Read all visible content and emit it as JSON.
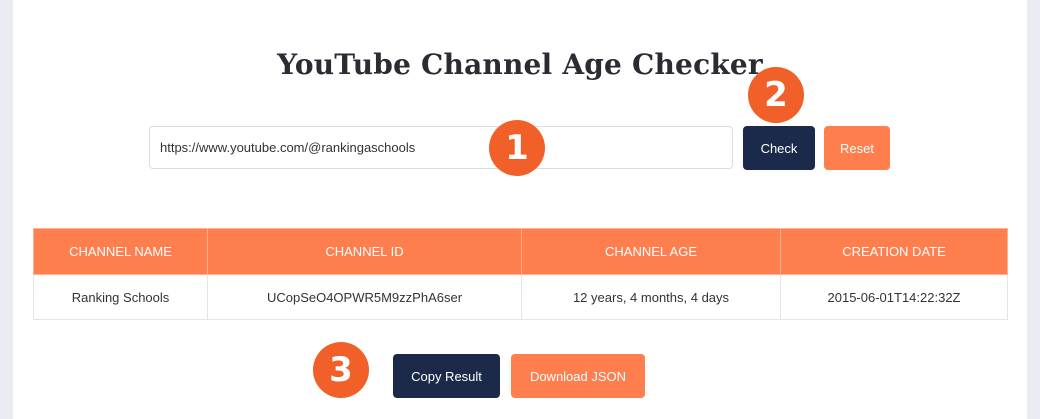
{
  "page": {
    "title": "YouTube Channel Age Checker"
  },
  "form": {
    "url_value": "https://www.youtube.com/@rankingaschools",
    "check_label": "Check",
    "reset_label": "Reset"
  },
  "table": {
    "headers": [
      "CHANNEL NAME",
      "CHANNEL ID",
      "CHANNEL AGE",
      "CREATION DATE"
    ],
    "rows": [
      [
        "Ranking Schools",
        "UCopSeO4OPWR5M9zzPhA6ser",
        "12 years, 4 months, 4 days",
        "2015-06-01T14:22:32Z"
      ]
    ]
  },
  "actions": {
    "copy_label": "Copy Result",
    "download_label": "Download JSON"
  },
  "badges": {
    "step1": "1",
    "step2": "2",
    "step3": "3"
  },
  "colors": {
    "accent": "#ff7e4d",
    "dark": "#1b2a4a",
    "badge": "#f16028"
  }
}
